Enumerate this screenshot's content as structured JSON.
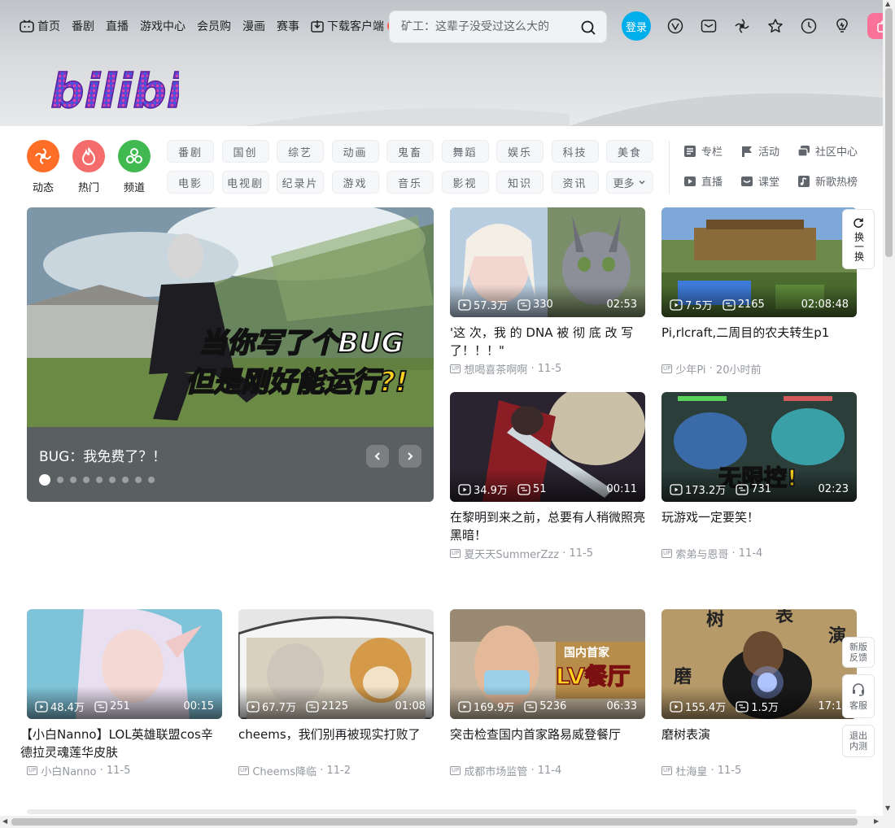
{
  "nav": {
    "items": [
      "首页",
      "番剧",
      "直播",
      "游戏中心",
      "会员购",
      "漫画",
      "赛事"
    ],
    "download": "下载客户端",
    "new_badge": "新"
  },
  "search": {
    "placeholder": "矿工：这辈子没受过这么大的"
  },
  "login": "登录",
  "logo_text": "bilibili",
  "channels": {
    "round": [
      "动态",
      "热门",
      "频道"
    ],
    "tags": [
      "番剧",
      "国创",
      "综艺",
      "动画",
      "鬼畜",
      "舞蹈",
      "娱乐",
      "科技",
      "美食",
      "电影",
      "电视剧",
      "纪录片",
      "游戏",
      "音乐",
      "影视",
      "知识",
      "资讯",
      "更多"
    ],
    "quick": [
      "专栏",
      "活动",
      "社区中心",
      "直播",
      "课堂",
      "新歌热榜"
    ]
  },
  "carousel": {
    "title": "BUG：我免费了？！",
    "overlay_line1": "当你写了个BUG",
    "overlay_line2": "但是刚好能运行?!",
    "slide_count": 9,
    "active_slide": 1
  },
  "videos": [
    {
      "views": "57.3万",
      "danmaku": "330",
      "duration": "02:53",
      "title": "'这 次，我 的 DNA 被 彻 底 改 写 了！！！\"",
      "author": "想喝喜茶啊啊",
      "date": "11-5"
    },
    {
      "views": "7.5万",
      "danmaku": "2165",
      "duration": "02:08:48",
      "title": "Pi,rlcraft,二周目的农夫转生p1",
      "author": "少年Pi",
      "date": "20小时前"
    },
    {
      "views": "34.9万",
      "danmaku": "51",
      "duration": "00:11",
      "title": "在黎明到来之前，总要有人稍微照亮黑暗！",
      "author": "夏天天SummerZzz",
      "date": "11-5"
    },
    {
      "views": "173.2万",
      "danmaku": "731",
      "duration": "02:23",
      "title": "玩游戏一定要笑！",
      "author": "索弟与恩哥",
      "date": "11-4",
      "overlay": "无限控!"
    },
    {
      "views": "48.4万",
      "danmaku": "251",
      "duration": "00:15",
      "title": "【小白Nanno】LOL英雄联盟cos辛德拉灵魂莲华皮肤",
      "author": "小白Nanno",
      "date": "11-5"
    },
    {
      "views": "67.7万",
      "danmaku": "2125",
      "duration": "01:08",
      "title": "cheems，我们别再被现实打败了",
      "author": "Cheems降临",
      "date": "11-2"
    },
    {
      "views": "169.9万",
      "danmaku": "5236",
      "duration": "06:33",
      "title": "突击检查国内首家路易威登餐厅",
      "author": "成都市场监管",
      "date": "11-4",
      "overlay1": "国内首家",
      "overlay2": "LV餐厅"
    },
    {
      "views": "155.4万",
      "danmaku": "1.5万",
      "duration": "17:16",
      "title": "磨树表演",
      "author": "杜海皇",
      "date": "11-5",
      "overlay_chars": [
        "磨",
        "树",
        "表",
        "演"
      ]
    }
  ],
  "float": {
    "refresh": "换一换",
    "feedback": "新版反馈",
    "service": "客服",
    "exit": "退出内测"
  },
  "colors": {
    "brand_blue": "#00aeec",
    "brand_pink": "#fb7299",
    "dynamic": "#ff6e27",
    "hot": "#f56c6c",
    "channel": "#3fb950"
  }
}
